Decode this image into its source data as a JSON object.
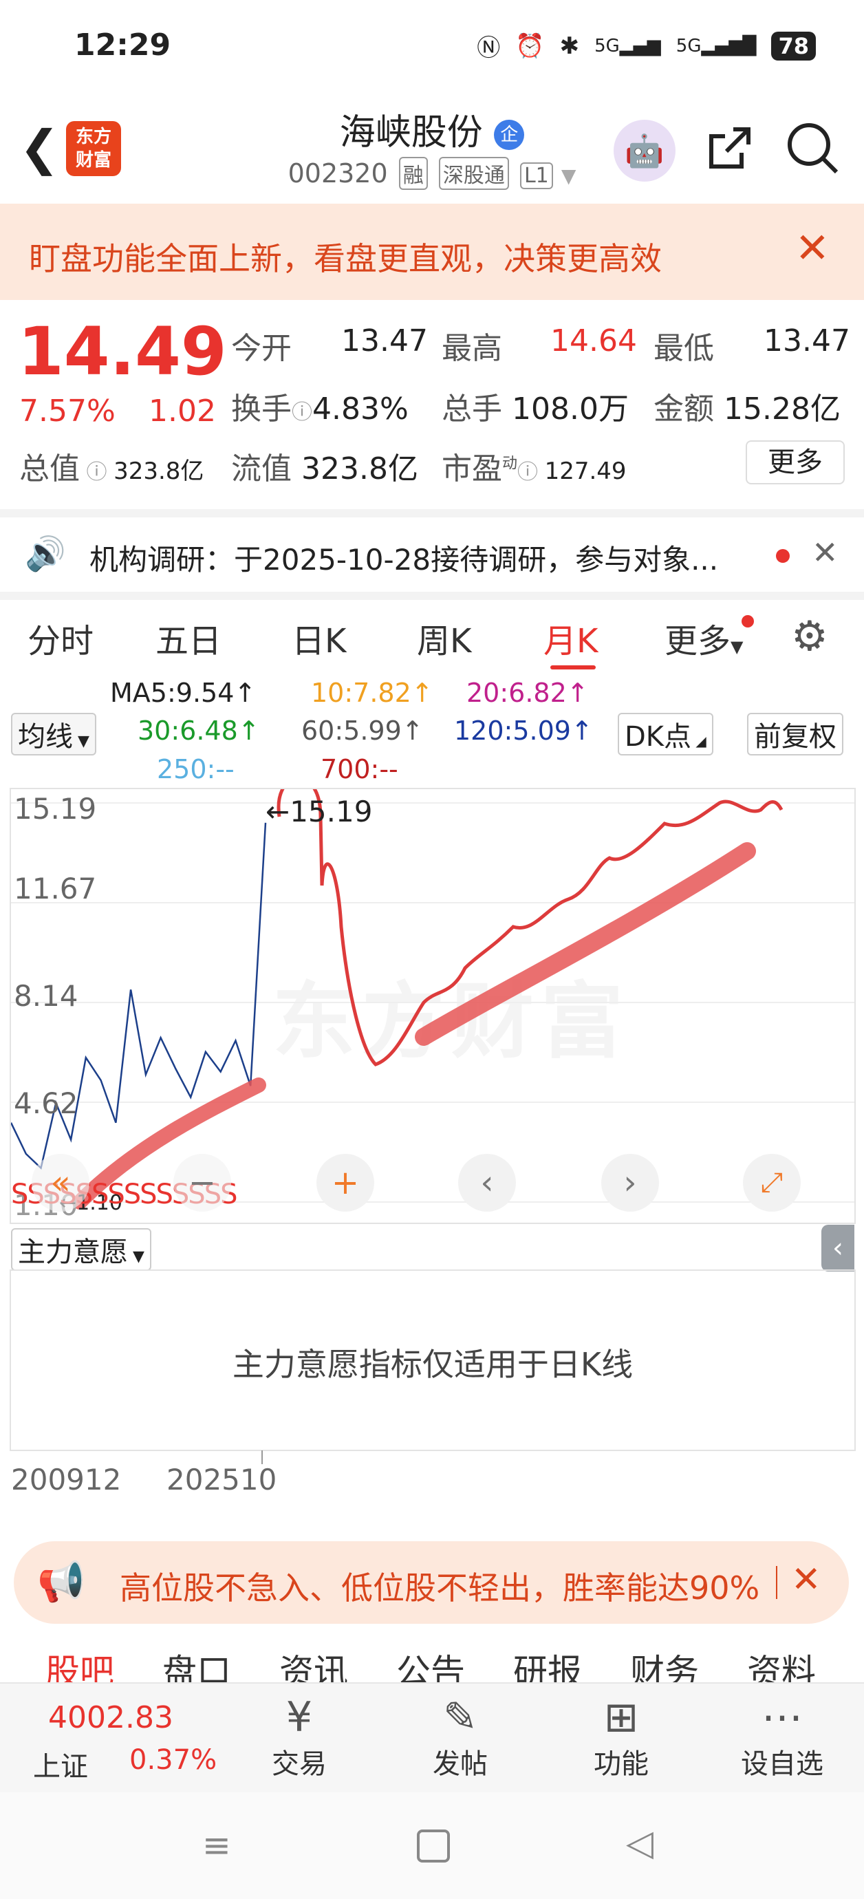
{
  "status_bar": {
    "time": "12:29",
    "battery": "78",
    "network1": "5G",
    "network2": "5G"
  },
  "header": {
    "stock_name": "海峡股份",
    "badge": "企",
    "code": "002320",
    "tags": [
      "融",
      "深股通",
      "L1"
    ],
    "logo_text": "东方财富"
  },
  "banner": {
    "text": "盯盘功能全面上新，看盘更直观，决策更高效"
  },
  "quote": {
    "price": "14.49",
    "change_pct": "7.57%",
    "change": "1.02",
    "open_label": "今开",
    "open": "13.47",
    "high_label": "最高",
    "high": "14.64",
    "low_label": "最低",
    "low": "13.47",
    "turnover_label": "换手",
    "turnover": "4.83%",
    "volume_label": "总手",
    "volume": "108.0万",
    "amount_label": "金额",
    "amount": "15.28亿",
    "mktcap_label": "总值",
    "mktcap": "323.8亿",
    "float_label": "流值",
    "float": "323.8亿",
    "pe_label": "市盈",
    "pe_sup": "动",
    "pe": "127.49",
    "more": "更多"
  },
  "notice": {
    "text": "机构调研：于2025-10-28接待调研，参与对象..."
  },
  "tabs": [
    "分时",
    "五日",
    "日K",
    "周K",
    "月K",
    "更多"
  ],
  "active_tab": "月K",
  "ma": {
    "selector": "均线",
    "ma5": "MA5:9.54↑",
    "ma10": "10:7.82↑",
    "ma20": "20:6.82↑",
    "ma30": "30:6.48↑",
    "ma60": "60:5.99↑",
    "ma120": "120:5.09↑",
    "ma250": "250:--",
    "ma700": "700:--",
    "dk": "DK点",
    "fq": "前复权"
  },
  "chart": {
    "y_ticks": [
      "15.19",
      "11.67",
      "8.14",
      "4.62",
      "1.10"
    ],
    "max_label": "←15.19",
    "min_label": "←1.10",
    "annotation": "SSSSSSSSSSSSSS",
    "watermark": "东方财富",
    "colors": {
      "ma5": "#222222",
      "ma10": "#f0a020",
      "ma20": "#c0208c",
      "ma30": "#1a9a2a",
      "ma60": "#555555",
      "ma120": "#1a3aa0",
      "ma250": "#5ab0e0",
      "ma700": "#c02020"
    }
  },
  "chart_data": {
    "type": "line",
    "xlabel": "",
    "ylabel": "",
    "x": [
      "200912",
      "202510"
    ],
    "ylim": [
      1.1,
      15.19
    ],
    "series": [
      {
        "values": [
          3.9,
          2.8,
          2.3,
          4.6,
          3.3,
          6.2,
          5.4,
          3.9,
          8.6,
          5.6,
          6.9,
          5.8,
          4.8,
          6.4,
          5.7,
          6.8,
          5.2,
          14.49
        ]
      }
    ]
  },
  "indicator": {
    "selector": "主力意愿",
    "message": "主力意愿指标仅适用于日K线"
  },
  "x_axis": {
    "start": "200912",
    "end": "202510"
  },
  "ad": {
    "text": "高位股不急入、低位股不轻出，胜率能达90%"
  },
  "bottom_tabs": [
    "股吧",
    "盘口",
    "资讯",
    "公告",
    "研报",
    "财务",
    "资料"
  ],
  "bottom_bar": {
    "index_value": "4002.83",
    "index_name": "上证",
    "index_pct": "0.37%",
    "trade": "交易",
    "post": "发帖",
    "func": "功能",
    "watch": "设自选"
  }
}
